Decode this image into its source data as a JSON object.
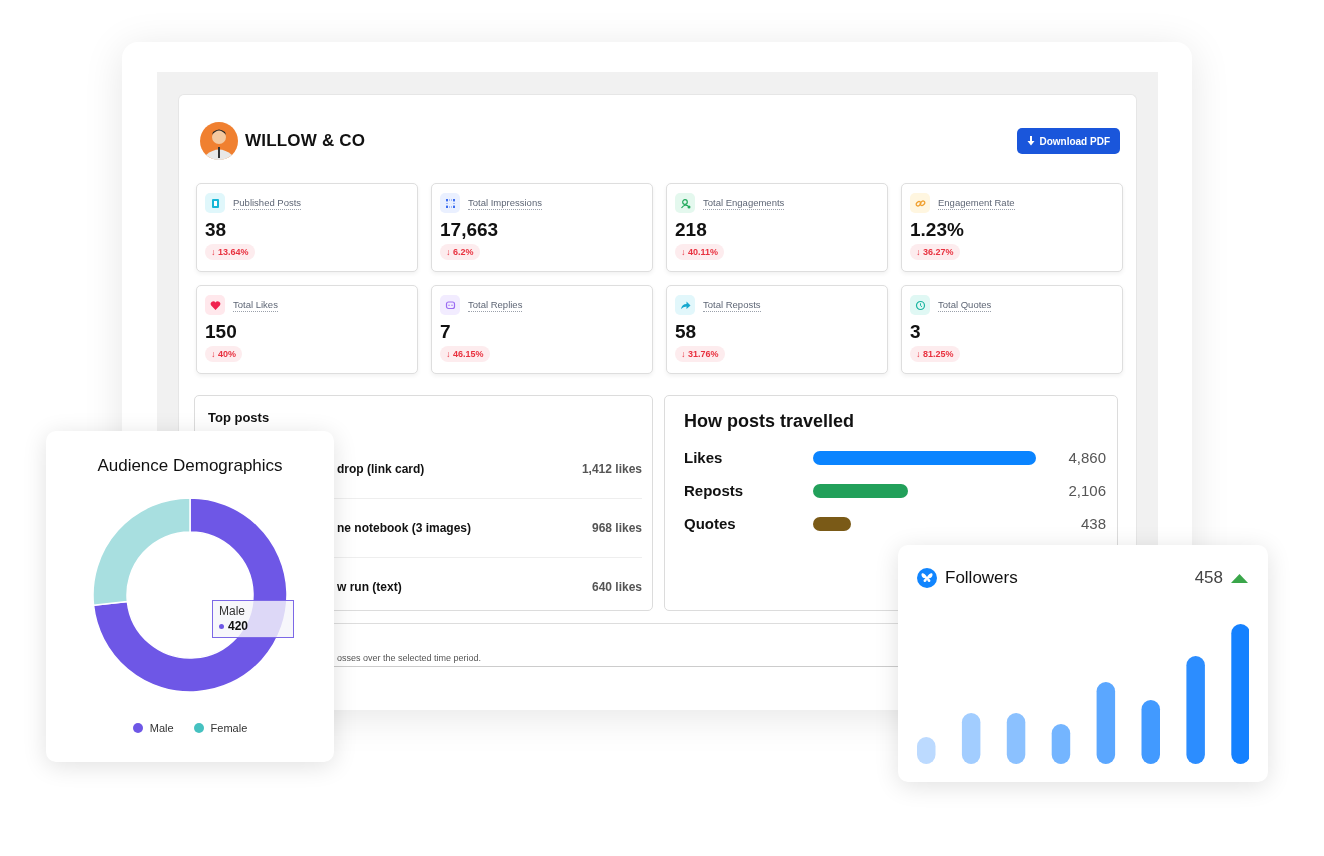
{
  "header": {
    "brand": "WILLOW & CO",
    "download_button": "Download PDF"
  },
  "stats": [
    {
      "kind": "posts",
      "label": "Published Posts",
      "value": "38",
      "change": "↓ 13.64%"
    },
    {
      "kind": "impressions",
      "label": "Total Impressions",
      "value": "17,663",
      "change": "↓ 6.2%"
    },
    {
      "kind": "engagements",
      "label": "Total Engagements",
      "value": "218",
      "change": "↓ 40.11%"
    },
    {
      "kind": "rate",
      "label": "Engagement Rate",
      "value": "1.23%",
      "change": "↓ 36.27%"
    },
    {
      "kind": "likes",
      "label": "Total Likes",
      "value": "150",
      "change": "↓ 40%"
    },
    {
      "kind": "replies",
      "label": "Total Replies",
      "value": "7",
      "change": "↓ 46.15%"
    },
    {
      "kind": "reposts",
      "label": "Total Reposts",
      "value": "58",
      "change": "↓ 31.76%"
    },
    {
      "kind": "quotes",
      "label": "Total Quotes",
      "value": "3",
      "change": "↓ 81.25%"
    }
  ],
  "top_posts": {
    "title": "Top posts",
    "rows": [
      {
        "post": "drop (link card)",
        "likes": "1,412 likes"
      },
      {
        "post": "ne notebook (3 images)",
        "likes": "968 likes"
      },
      {
        "post": "w run (text)",
        "likes": "640 likes"
      }
    ]
  },
  "travel": {
    "title": "How posts travelled",
    "rows": [
      {
        "label": "Likes",
        "value": "4,860",
        "color": "#0a84ff"
      },
      {
        "label": "Reposts",
        "value": "2,106",
        "color": "#22a05a"
      },
      {
        "label": "Quotes",
        "value": "438",
        "color": "#7a5a17"
      }
    ]
  },
  "footnote": "osses over the selected time period.",
  "demographics": {
    "title": "Audience Demographics",
    "tooltip": {
      "label": "Male",
      "value": "420"
    },
    "legend": [
      {
        "label": "Male",
        "color": "#6e57e6"
      },
      {
        "label": "Female",
        "color": "#45c1c0"
      }
    ]
  },
  "followers": {
    "title": "Followers",
    "count": "458"
  }
}
